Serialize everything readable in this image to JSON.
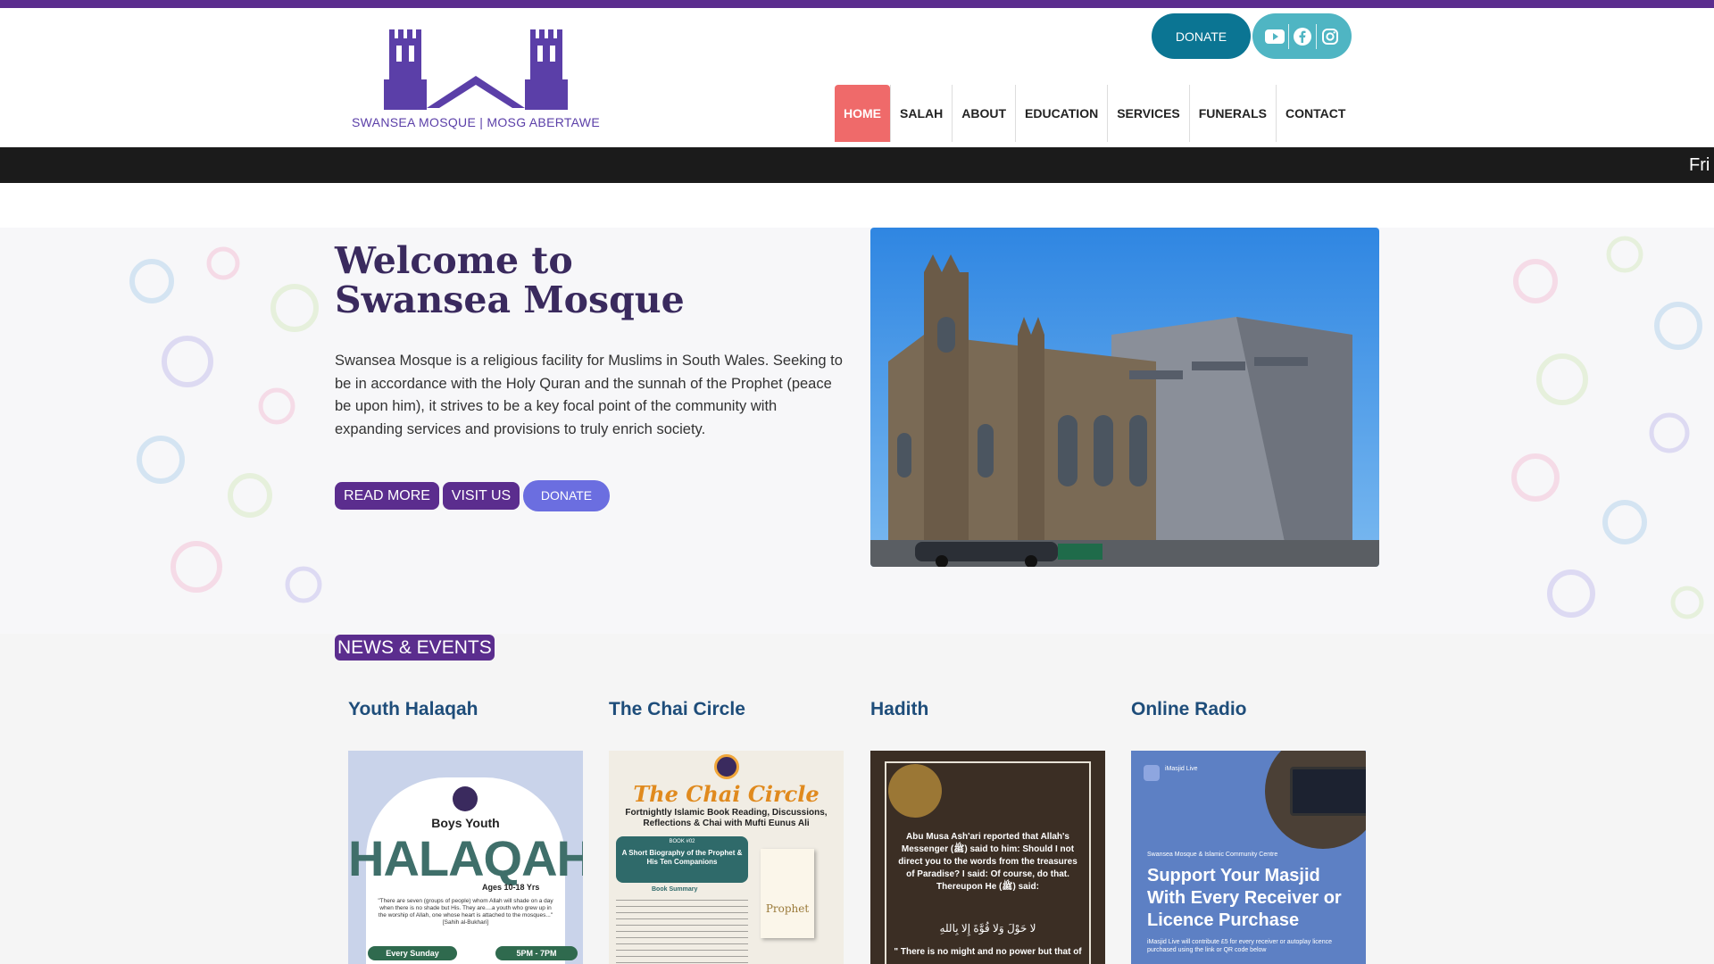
{
  "header": {
    "logo_text": "SWANSEA MOSQUE | MOSG ABERTAWE",
    "donate_label": "DONATE",
    "social_icons": [
      "youtube-icon",
      "facebook-icon",
      "instagram-icon"
    ],
    "nav": [
      {
        "label": "HOME",
        "active": true
      },
      {
        "label": "SALAH",
        "active": false
      },
      {
        "label": "ABOUT",
        "active": false
      },
      {
        "label": "EDUCATION",
        "active": false
      },
      {
        "label": "SERVICES",
        "active": false
      },
      {
        "label": "FUNERALS",
        "active": false
      },
      {
        "label": "CONTACT",
        "active": false
      }
    ]
  },
  "ticker": {
    "text": "Fri"
  },
  "hero": {
    "title_line1": "Welcome to",
    "title_line2": "Swansea Mosque",
    "body": "Swansea Mosque is a religious facility for Muslims in South Wales. Seeking to be in accordance with the Holy Quran and the sunnah of the Prophet (peace be upon him), it strives to be a key focal point of the community with expanding services and provisions to truly enrich society.",
    "read_more": "READ MORE",
    "visit_us": "VISIT US",
    "donate": "DONATE"
  },
  "news": {
    "label": "NEWS & EVENTS",
    "cards": [
      {
        "title": "Youth Halaqah",
        "poster": {
          "sub": "Boys Youth",
          "main": "HALAQAH",
          "ages": "Ages 10-18 Yrs",
          "quote": "\"There are seven (groups of people) whom Allah will shade on a day when there is no shade but His. They are....a youth who grew up in the worship of Allah, one whose heart is attached to the mosques...\" [Sahih al-Bukhari]",
          "day": "Every Sunday",
          "time": "5PM - 7PM"
        }
      },
      {
        "title": "The Chai Circle",
        "poster": {
          "main": "The Chai Circle",
          "sub": "Fortnightly Islamic Book Reading, Discussions, Reflections & Chai with Mufti Eunus Ali",
          "book_tag": "BOOK #02",
          "book_title": "A Short Biography of the Prophet & His Ten Companions",
          "summary_label": "Book Summary",
          "cover": "Prophet"
        }
      },
      {
        "title": "Hadith",
        "poster": {
          "text": "Abu Musa Ash'ari reported that Allah's Messenger (ﷺ) said to him: Should I not direct you to the words from the treasures of Paradise? I said: Of course, do that. Thereupon He (ﷺ) said:",
          "arabic": "لا حَوْلَ وَلا قُوَّةَ إِلا بِاللهِ",
          "footer": "\" There is no might and no power but that of"
        }
      },
      {
        "title": "Online Radio",
        "poster": {
          "brand": "iMasjid Live",
          "org": "Swansea Mosque & Islamic Community Centre",
          "headline": "Support Your Masjid With Every Receiver or Licence Purchase",
          "sub": "iMasjid Live will contribute £5 for every receiver or autoplay licence purchased using the link or QR code below"
        }
      }
    ]
  },
  "colors": {
    "primary": "#5b2d8e",
    "accent": "#ef6a6a",
    "teal": "#0b7593",
    "link": "#1e4d7a"
  }
}
